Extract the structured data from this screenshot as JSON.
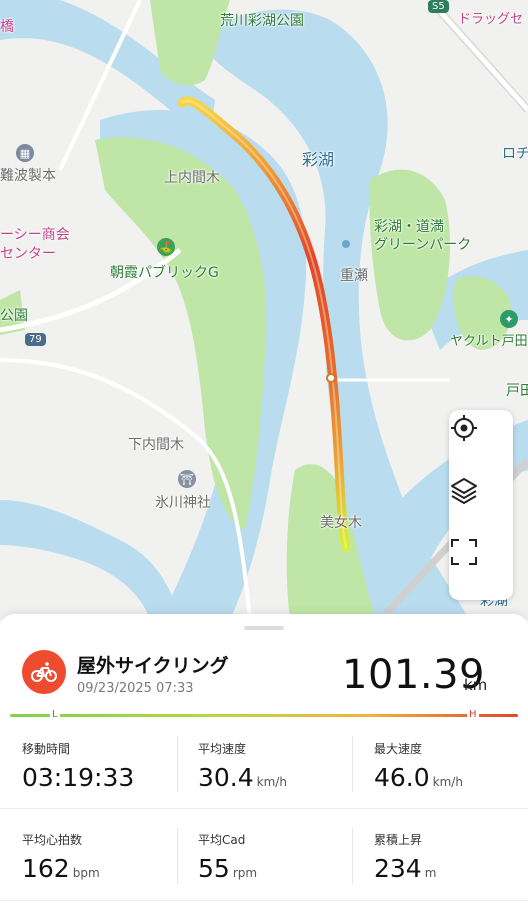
{
  "map": {
    "labels": {
      "araka_park": "荒川彩湖公園",
      "saiko": "彩湖",
      "kaminaiki": "上内間木",
      "saiko_green_park": "彩湖・道満\nグリーンパーク",
      "jyuse": "重瀬",
      "asaka_public": "朝霞パブリックG",
      "shimonaiki": "下内間木",
      "hikawa": "氷川神社",
      "tenjyogi": "美女木",
      "yakult": "ヤクルト戸田",
      "toda": "戸田",
      "roche": "ロチ",
      "drugstore": "ドラッグセ",
      "shop_a": "ーシー商会",
      "shop_b": "センター",
      "namba": "難波製本",
      "bridge": "橋",
      "park_left": "公園",
      "sai_bottom": "彩湖"
    },
    "road_badges": {
      "r79": "79",
      "s5": "S5"
    },
    "controls": {
      "locate": "locate-icon",
      "layers": "layers-icon",
      "fullscreen": "fullscreen-icon"
    }
  },
  "activity": {
    "icon": "bicycle-icon",
    "title": "屋外サイクリング",
    "datetime": "09/23/2025 07:33",
    "distance": "101.39",
    "distance_unit": "km",
    "gradient_low": "L",
    "gradient_high": "H",
    "accent_color": "#ef4b2f"
  },
  "stats": [
    {
      "label": "移動時間",
      "value": "03:19:33",
      "unit": ""
    },
    {
      "label": "平均速度",
      "value": "30.4",
      "unit": "km/h"
    },
    {
      "label": "最大速度",
      "value": "46.0",
      "unit": "km/h"
    },
    {
      "label": "平均心拍数",
      "value": "162",
      "unit": "bpm"
    },
    {
      "label": "平均Cad",
      "value": "55",
      "unit": "rpm"
    },
    {
      "label": "累積上昇",
      "value": "234",
      "unit": "m"
    }
  ]
}
